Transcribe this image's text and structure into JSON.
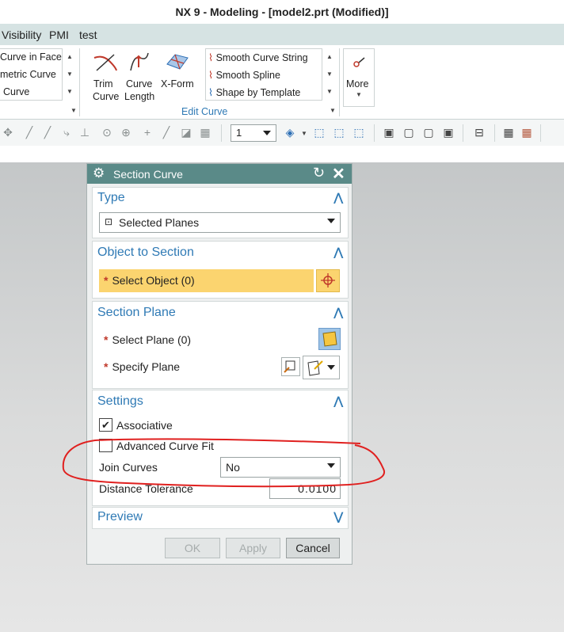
{
  "window": {
    "title": "NX 9 - Modeling - [model2.prt (Modified)]"
  },
  "menu": {
    "items": [
      "Visibility",
      "PMI",
      "test"
    ]
  },
  "ribbon": {
    "left_list": [
      "Curve in Face",
      "metric Curve",
      "Curve"
    ],
    "trim_curve": "Trim\nCurve",
    "trim_l1": "Trim",
    "trim_l2": "Curve",
    "curve_length_l1": "Curve",
    "curve_length_l2": "Length",
    "xform": "X-Form",
    "right_list": [
      "Smooth Curve String",
      "Smooth Spline",
      "Shape by Template"
    ],
    "group_label": "Edit Curve",
    "more": "More"
  },
  "toolbar": {
    "zoom_value": "1"
  },
  "dialog": {
    "title": "Section Curve",
    "type": {
      "header": "Type",
      "value": "Selected Planes"
    },
    "object": {
      "header": "Object to Section",
      "select_label": "Select Object (0)"
    },
    "plane": {
      "header": "Section Plane",
      "select_plane": "Select Plane (0)",
      "specify_plane": "Specify Plane"
    },
    "settings": {
      "header": "Settings",
      "associative": "Associative",
      "associative_checked": true,
      "advanced_fit": "Advanced Curve Fit",
      "advanced_fit_checked": false,
      "join_curves_label": "Join Curves",
      "join_curves_value": "No",
      "distance_tolerance_label": "Distance Tolerance",
      "distance_tolerance_value": "0.0100"
    },
    "preview": {
      "header": "Preview"
    },
    "buttons": {
      "ok": "OK",
      "apply": "Apply",
      "cancel": "Cancel"
    }
  },
  "colors": {
    "dialog_header": "#5a8a88",
    "section_header": "#2f7ab5",
    "highlight": "#fbd46f",
    "annotation": "#e0201f"
  }
}
